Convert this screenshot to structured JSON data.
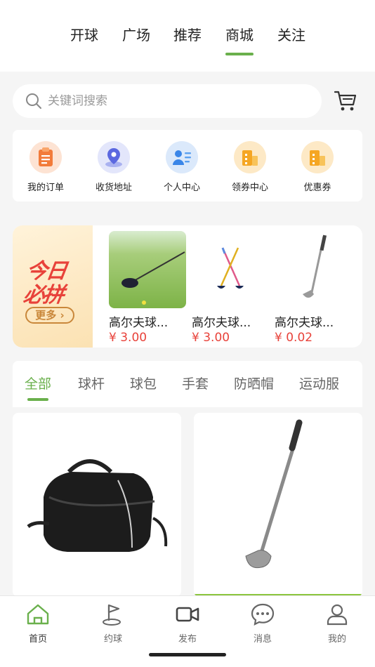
{
  "top_nav": {
    "tabs": [
      "开球",
      "广场",
      "推荐",
      "商城",
      "关注"
    ],
    "active": "商城"
  },
  "search": {
    "placeholder": "关键词搜索"
  },
  "quick_links": [
    {
      "label": "我的订单",
      "icon": "clipboard-icon"
    },
    {
      "label": "收货地址",
      "icon": "location-pin-icon"
    },
    {
      "label": "个人中心",
      "icon": "user-profile-icon"
    },
    {
      "label": "领券中心",
      "icon": "building-coupon-icon"
    },
    {
      "label": "优惠券",
      "icon": "coupon-icon"
    }
  ],
  "promo": {
    "banner_line1": "今日",
    "banner_line2": "必拼",
    "more_label": "更多 ›",
    "products": [
      {
        "name": "高尔夫球...",
        "price": "¥ 3.00"
      },
      {
        "name": "高尔夫球...",
        "price": "¥ 3.00"
      },
      {
        "name": "高尔夫球...",
        "price": "¥ 0.02"
      }
    ]
  },
  "categories": {
    "tabs": [
      "全部",
      "球杆",
      "球包",
      "手套",
      "防晒帽",
      "运动服"
    ],
    "active": "全部"
  },
  "bottom_tabs": [
    {
      "label": "首页",
      "icon": "home-icon"
    },
    {
      "label": "约球",
      "icon": "golf-flag-icon"
    },
    {
      "label": "发布",
      "icon": "video-camera-icon"
    },
    {
      "label": "消息",
      "icon": "chat-bubble-icon"
    },
    {
      "label": "我的",
      "icon": "user-icon"
    }
  ],
  "colors": {
    "accent": "#6ab04c",
    "price": "#e8423a"
  }
}
